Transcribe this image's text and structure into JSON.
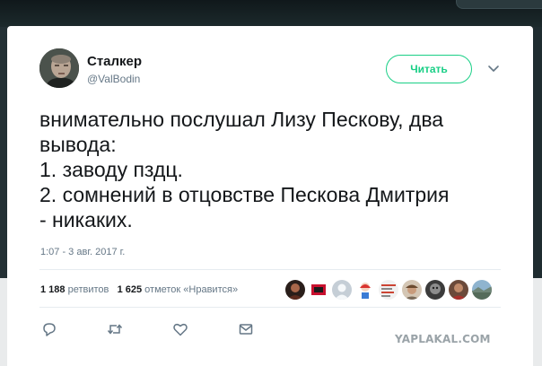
{
  "user": {
    "name": "Сталкер",
    "handle": "@ValBodin",
    "follow_label": "Читать"
  },
  "tweet": {
    "lines": [
      "внимательно послушал Лизу Пескову, два",
      "вывода:",
      "1. заводу пздц.",
      "2. сомнений в отцовстве Пескова Дмитрия",
      "- никаких."
    ],
    "timestamp": "1:07 - 3 авг. 2017 г."
  },
  "stats": {
    "retweets_count": "1 188",
    "retweets_label": "ретвитов",
    "likes_count": "1 625",
    "likes_label": "отметок «Нравится»"
  },
  "likers": [
    {
      "icon": "avatar-dark-portrait"
    },
    {
      "icon": "avatar-red-logo"
    },
    {
      "icon": "avatar-default-egg"
    },
    {
      "icon": "avatar-cartoon"
    },
    {
      "icon": "avatar-text-image"
    },
    {
      "icon": "avatar-man-cap"
    },
    {
      "icon": "avatar-dark-face"
    },
    {
      "icon": "avatar-man-portrait"
    },
    {
      "icon": "avatar-landscape"
    }
  ],
  "actions": [
    {
      "icon": "reply-icon"
    },
    {
      "icon": "retweet-icon"
    },
    {
      "icon": "like-icon"
    },
    {
      "icon": "message-icon"
    }
  ],
  "watermark": "YAPLAKAL.COM",
  "colors": {
    "accent": "#19cf86",
    "text": "#14171a",
    "muted": "#657786"
  }
}
